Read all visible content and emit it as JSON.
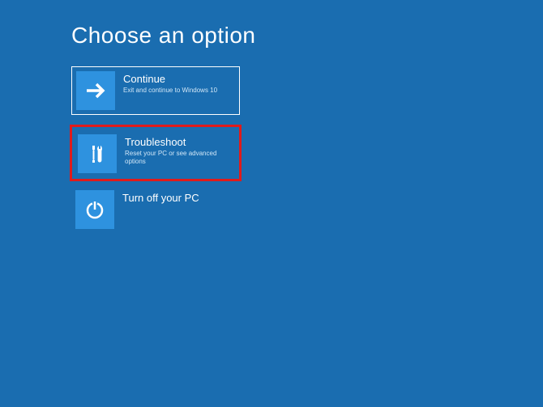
{
  "title": "Choose an option",
  "options": [
    {
      "icon": "arrow-right",
      "title": "Continue",
      "desc": "Exit and continue to Windows 10"
    },
    {
      "icon": "tools",
      "title": "Troubleshoot",
      "desc": "Reset your PC or see advanced options"
    },
    {
      "icon": "power",
      "title": "Turn off your PC",
      "desc": ""
    }
  ]
}
